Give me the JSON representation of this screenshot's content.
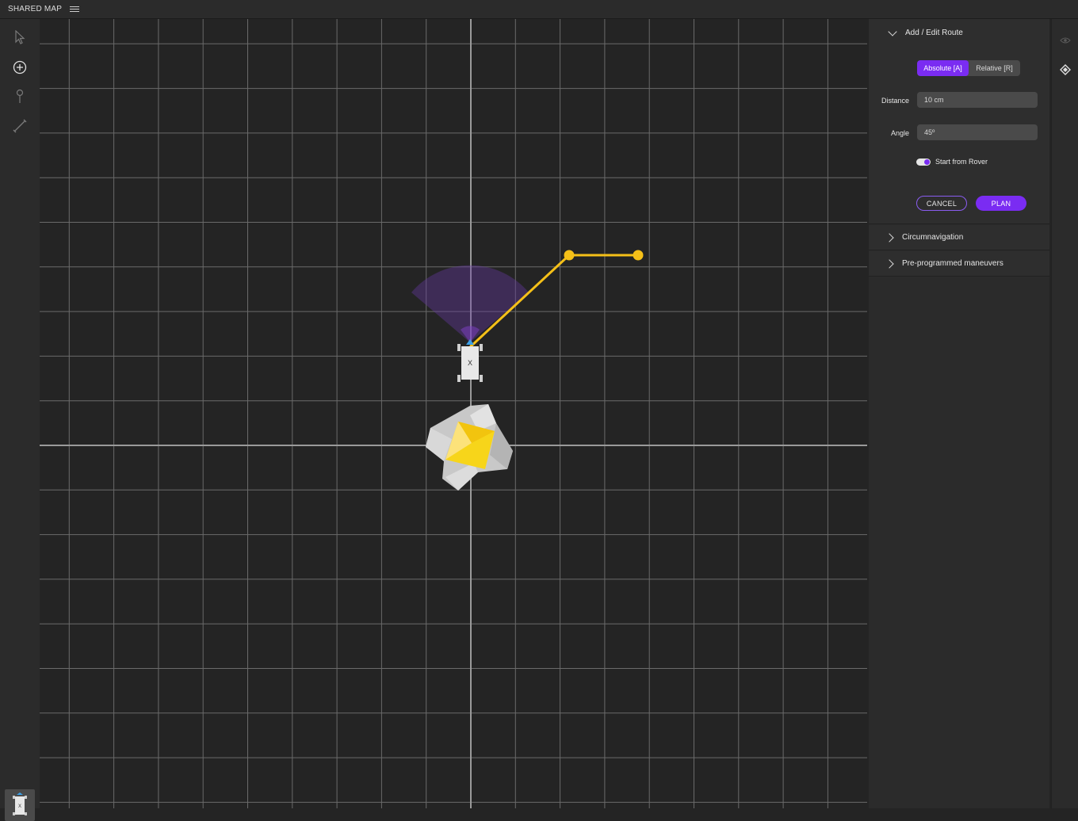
{
  "app": {
    "title": "SHARED MAP"
  },
  "toolbar": {
    "tools": [
      "select-pointer",
      "add-circle",
      "waypoint-pin",
      "measure-ruler"
    ]
  },
  "rover": {
    "label": "X"
  },
  "panel": {
    "route": {
      "title": "Add / Edit Route",
      "mode_absolute": "Absolute [A]",
      "mode_relative": "Relative [R]",
      "distance_label": "Distance",
      "distance_value": "10 cm",
      "angle_label": "Angle",
      "angle_value": "45º",
      "start_from_rover_label": "Start from Rover",
      "start_from_rover": true,
      "cancel_label": "CANCEL",
      "plan_label": "PLAN"
    },
    "circumnavigation_label": "Circumnavigation",
    "maneuvers_label": "Pre-programmed maneuvers"
  },
  "colors": {
    "accent": "#7a2cf2",
    "route": "#f5c018",
    "background": "#242424",
    "grid": "#6a6a6a"
  }
}
